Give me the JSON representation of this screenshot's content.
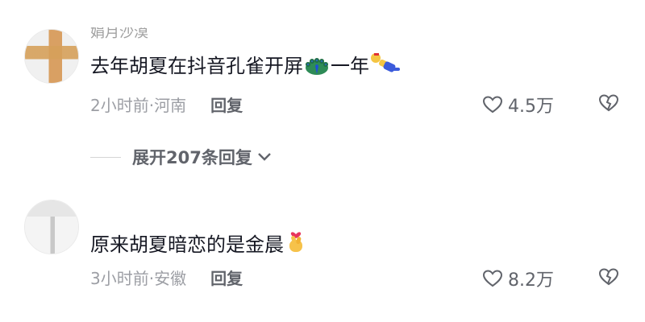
{
  "comments": [
    {
      "username": "娟月沙漠",
      "text": "去年胡夏在抖音孔雀开屏",
      "emoji1": "peacock-emoji",
      "text_after": "一年",
      "emoji2": "falling-person-emoji",
      "time_location": "2小时前·河南",
      "reply_label": "回复",
      "likes": "4.5万",
      "expand_label": "展开207条回复"
    },
    {
      "text": "原来胡夏暗恋的是金晨",
      "emoji1": "finger-heart-emoji",
      "time_location": "3小时前·安徽",
      "reply_label": "回复",
      "likes": "8.2万"
    }
  ]
}
